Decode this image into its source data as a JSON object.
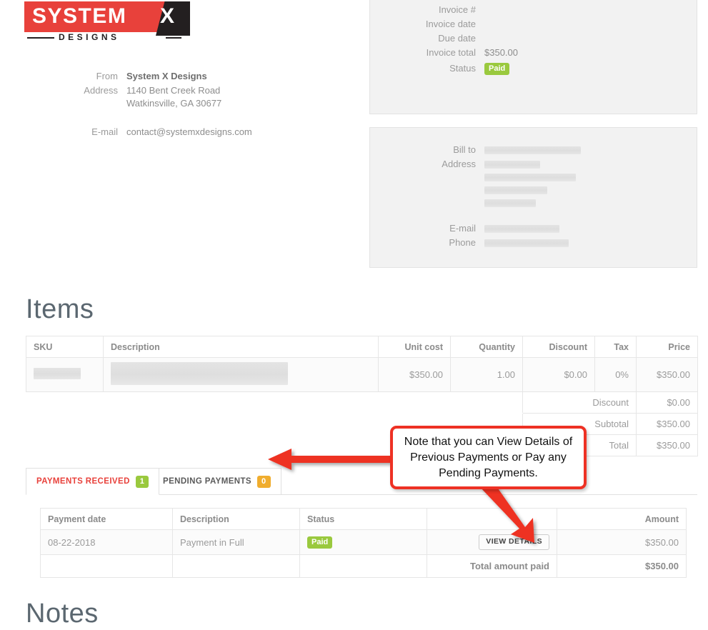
{
  "brand": {
    "logo_word": "SYSTEM",
    "logo_x": "X",
    "logo_sub": "DESIGNS"
  },
  "from_block": {
    "from_label": "From",
    "from_value": "System X Designs",
    "address_label": "Address",
    "address_line1": "1140 Bent Creek Road",
    "address_line2": "Watkinsville, GA 30677",
    "email_label": "E-mail",
    "email_value": "contact@systemxdesigns.com"
  },
  "invoice_panel": {
    "invoice_number_label": "Invoice #",
    "invoice_number_value": "",
    "invoice_date_label": "Invoice date",
    "invoice_date_value": "",
    "due_date_label": "Due date",
    "due_date_value": "",
    "invoice_total_label": "Invoice total",
    "invoice_total_value": "$350.00",
    "status_label": "Status",
    "status_value": "Paid"
  },
  "bill_to_panel": {
    "bill_to_label": "Bill to",
    "bill_to_value": "",
    "address_label": "Address",
    "address_value": "",
    "email_label": "E-mail",
    "email_value": "",
    "phone_label": "Phone",
    "phone_value": ""
  },
  "items": {
    "title": "Items",
    "columns": [
      "SKU",
      "Description",
      "Unit cost",
      "Quantity",
      "Discount",
      "Tax",
      "Price"
    ],
    "rows": [
      {
        "sku": "",
        "description": "",
        "unit_cost": "$350.00",
        "quantity": "1.00",
        "discount": "$0.00",
        "tax": "0%",
        "price": "$350.00"
      }
    ],
    "summary": [
      {
        "label": "Discount",
        "value": "$0.00"
      },
      {
        "label": "Subtotal",
        "value": "$350.00"
      },
      {
        "label": "Total",
        "value": "$350.00"
      }
    ]
  },
  "payment_tabs": [
    {
      "label": "PAYMENTS RECEIVED",
      "count": "1",
      "active": true
    },
    {
      "label": "PENDING PAYMENTS",
      "count": "0",
      "active": false
    }
  ],
  "payments": {
    "columns": [
      "Payment date",
      "Description",
      "Status",
      "",
      "Amount"
    ],
    "rows": [
      {
        "date": "08-22-2018",
        "description": "Payment in Full",
        "status": "Paid",
        "action": "VIEW DETAILS",
        "amount": "$350.00"
      }
    ],
    "total_label": "Total amount paid",
    "total_value": "$350.00"
  },
  "notes": {
    "title": "Notes"
  },
  "annotation": {
    "text": "Note that you can View Details of Previous Payments or Pay any Pending Payments."
  },
  "colors": {
    "brand_red": "#e8413b",
    "annotation_red": "#ee3124",
    "badge_green": "#9ac93e",
    "badge_orange": "#f0ad2e",
    "heading_slate": "#5b6770"
  }
}
